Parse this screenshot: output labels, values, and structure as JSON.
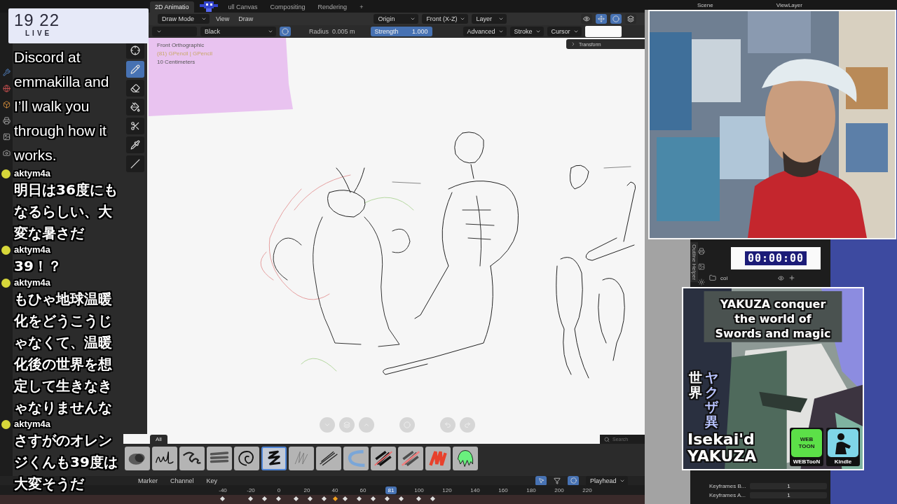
{
  "workspace_tabs": [
    {
      "label": "2D Animatio",
      "selected": true
    },
    {
      "label": "ull Canvas",
      "selected": false
    },
    {
      "label": "Compositing",
      "selected": false
    },
    {
      "label": "Rendering",
      "selected": false
    }
  ],
  "add_workspace": "+",
  "scene_bar": {
    "scene": "Scene",
    "view_layer": "ViewLayer"
  },
  "header": {
    "mode": "Draw Mode",
    "menus": [
      "View",
      "Draw"
    ],
    "pivot": "Origin",
    "orientation": "Front (X-Z)",
    "layer": "Layer"
  },
  "tool_settings": {
    "material": "Black",
    "radius_label": "Radius",
    "radius": "0.005 m",
    "strength_label": "Strength",
    "strength": "1.000",
    "level": 1,
    "menus": [
      "Advanced",
      "Stroke",
      "Cursor"
    ]
  },
  "tools": [
    {
      "kind": "cursor",
      "selected": false
    },
    {
      "kind": "draw",
      "selected": true
    },
    {
      "kind": "erase",
      "selected": false
    },
    {
      "kind": "fill",
      "selected": false
    },
    {
      "kind": "cutter",
      "selected": false
    },
    {
      "kind": "eyedropper",
      "selected": false
    },
    {
      "kind": "line",
      "selected": false
    }
  ],
  "viewport": {
    "info": [
      {
        "text": "Front Orthographic",
        "kind": "plain"
      },
      {
        "text": "(81) GPencil | GPencil",
        "kind": "object"
      },
      {
        "text": "10 Centimeters",
        "kind": "plain"
      }
    ],
    "transform_panel": "Transform"
  },
  "asset_shelf": {
    "tab": "All",
    "search_placeholder": "Search",
    "brushes": [
      {
        "kind": "airbrush",
        "selected": false
      },
      {
        "kind": "script",
        "selected": false
      },
      {
        "kind": "scribble",
        "selected": false
      },
      {
        "kind": "marker",
        "selected": false
      },
      {
        "kind": "spiral",
        "selected": false
      },
      {
        "kind": "zigzag",
        "selected": true
      },
      {
        "kind": "pencil",
        "selected": false
      },
      {
        "kind": "hatch",
        "selected": false
      },
      {
        "kind": "wave",
        "selected": false
      },
      {
        "kind": "eraser",
        "selected": false
      },
      {
        "kind": "eraser-soft",
        "selected": false
      },
      {
        "kind": "fill-red",
        "selected": false
      },
      {
        "kind": "drip",
        "selected": false
      }
    ]
  },
  "timeline": {
    "menus": [
      "Marker",
      "Channel",
      "Key"
    ],
    "frames": [
      {
        "label": "-40",
        "current": false
      },
      {
        "label": "-20",
        "current": false
      },
      {
        "label": "0",
        "current": false
      },
      {
        "label": "20",
        "current": false
      },
      {
        "label": "40",
        "current": false
      },
      {
        "label": "60",
        "current": false
      },
      {
        "label": "81",
        "current": true
      },
      {
        "label": "100",
        "current": false
      },
      {
        "label": "120",
        "current": false
      },
      {
        "label": "140",
        "current": false
      },
      {
        "label": "160",
        "current": false
      },
      {
        "label": "180",
        "current": false
      },
      {
        "label": "200",
        "current": false
      },
      {
        "label": "220",
        "current": false
      }
    ],
    "playhead": "Playhead"
  },
  "right_panel": {
    "vertical_tab": "Outline Helper",
    "collection": "col",
    "properties": [
      {
        "label": "Keyframes B...",
        "value": "1"
      },
      {
        "label": "Keyframes A...",
        "value": "1"
      }
    ]
  },
  "stream": {
    "clock": {
      "time": "19 22",
      "live": "LIVE"
    },
    "timer": "00:00:00",
    "caption": "Discord at emmakilla and I’ll walk you through how it works.",
    "chat": [
      {
        "user": "aktym4a",
        "text": "明日は36度にもなるらしい、大変な暑さだ"
      },
      {
        "user": "aktym4a",
        "text": "39！？"
      },
      {
        "user": "aktym4a",
        "text": "もひゃ地球温暖化をどうこうじゃなくて、温暖化後の世界を想定して生きなきゃなりませんな"
      },
      {
        "user": "aktym4a",
        "text": "さすがのオレンジくんも39度は大変そうだ"
      }
    ],
    "ad": {
      "title": "YAKUZA conquer the world of Swords and magic",
      "jp_columns": [
        "世界",
        "ヤクザ異"
      ],
      "name_lines": [
        "Isekai'd",
        "YAKUZA"
      ],
      "badges": [
        {
          "kind": "webtoon",
          "logo": "WEB TOON",
          "caption": "WEBTooN"
        },
        {
          "kind": "kindle",
          "caption": "Kindle"
        }
      ]
    }
  }
}
